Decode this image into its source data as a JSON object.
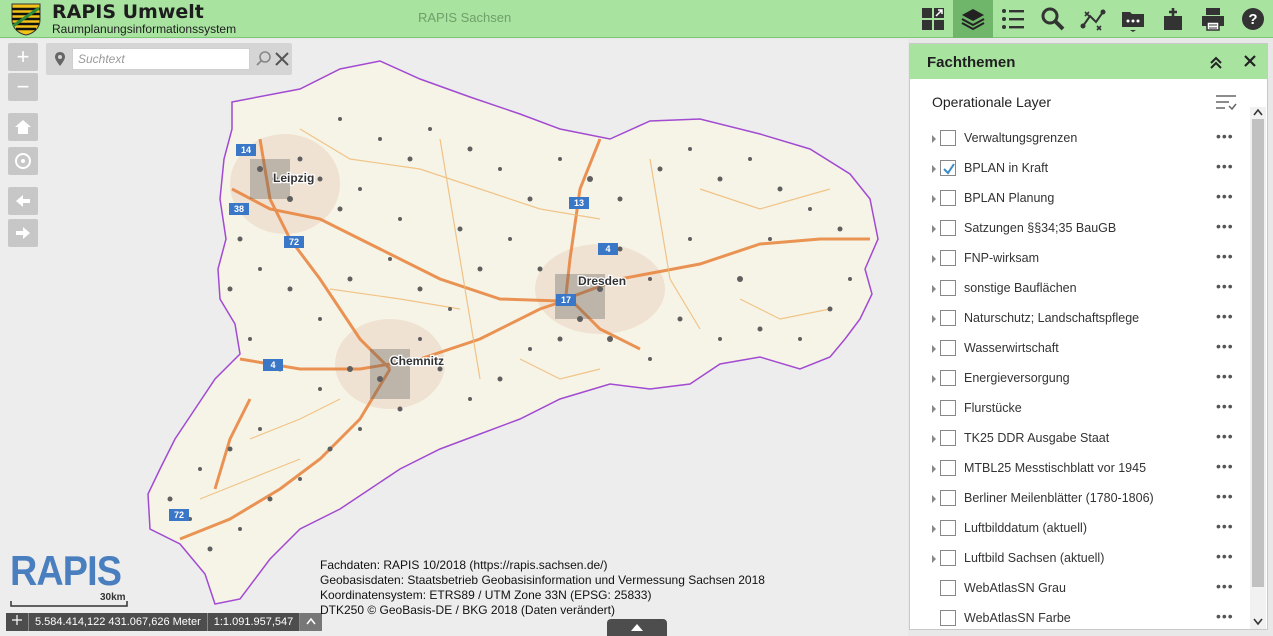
{
  "header": {
    "title": "RAPIS Umwelt",
    "subtitle": "Raumplanungsinformationssystem",
    "center_title": "RAPIS Sachsen",
    "tools": [
      {
        "icon": "overview-icon"
      },
      {
        "icon": "layers-icon",
        "active": true
      },
      {
        "icon": "legend-icon"
      },
      {
        "icon": "search-icon"
      },
      {
        "icon": "measure-icon"
      },
      {
        "icon": "folder-more-icon"
      },
      {
        "icon": "bookmark-add-icon"
      },
      {
        "icon": "print-icon"
      },
      {
        "icon": "help-icon"
      }
    ]
  },
  "map": {
    "zoom_in": "+",
    "zoom_out": "−",
    "search_placeholder": "Suchtext",
    "logo_text": "RAPIS",
    "scale_label": "30km",
    "status": {
      "coordinates": "5.584.414,122 431.067,626 Meter",
      "scale": "1:1.091.957,547"
    },
    "attribution": [
      "Fachdaten: RAPIS 10/2018 (https://rapis.sachsen.de/)",
      "Geobasisdaten: Staatsbetrieb Geobasisinformation und Vermessung Sachsen 2018",
      "Koordinatensystem: ETRS89 / UTM Zone 33N (EPSG: 25833)",
      "DTK250 © GeoBasis-DE / BKG 2018 (Daten verändert)"
    ],
    "city_labels": [
      "Leipzig",
      "Dresden",
      "Chemnitz"
    ],
    "road_shields": [
      "14",
      "38",
      "72",
      "13",
      "4",
      "17",
      "4",
      "72"
    ],
    "colors": {
      "state_fill": "#f6f4e6",
      "state_border": "#a24ad1",
      "highway": "#e8823a",
      "settlement": "#5f5f5f",
      "shield": "#3a78c7"
    }
  },
  "panel": {
    "title": "Fachthemen",
    "heading": "Operationale Layer",
    "layers": [
      {
        "label": "Verwaltungsgrenzen",
        "checked": false
      },
      {
        "label": "BPLAN in Kraft",
        "checked": true
      },
      {
        "label": "BPLAN Planung",
        "checked": false
      },
      {
        "label": "Satzungen §§34;35 BauGB",
        "checked": false
      },
      {
        "label": "FNP-wirksam",
        "checked": false
      },
      {
        "label": "sonstige Bauflächen",
        "checked": false
      },
      {
        "label": "Naturschutz; Landschaftspflege",
        "checked": false
      },
      {
        "label": "Wasserwirtschaft",
        "checked": false
      },
      {
        "label": "Energieversorgung",
        "checked": false
      },
      {
        "label": "Flurstücke",
        "checked": false
      },
      {
        "label": "TK25 DDR Ausgabe Staat",
        "checked": false
      },
      {
        "label": "MTBL25 Messtischblatt vor 1945",
        "checked": false
      },
      {
        "label": "Berliner Meilenblätter (1780-1806)",
        "checked": false
      },
      {
        "label": "Luftbilddatum (aktuell)",
        "checked": false
      },
      {
        "label": "Luftbild Sachsen (aktuell)",
        "checked": false
      },
      {
        "label": "WebAtlasSN Grau",
        "checked": false
      },
      {
        "label": "WebAtlasSN Farbe",
        "checked": false
      }
    ],
    "menu_glyph": "•••"
  }
}
